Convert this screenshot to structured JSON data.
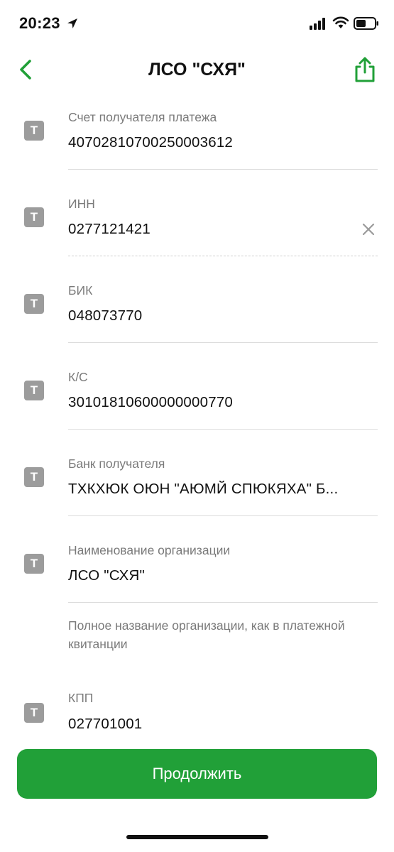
{
  "status_bar": {
    "time": "20:23",
    "icons": [
      "location-arrow-icon",
      "signal-icon",
      "wifi-icon",
      "battery-icon"
    ]
  },
  "nav": {
    "title": "ЛСО \"СХЯ\"",
    "back_icon": "chevron-left-icon",
    "share_icon": "share-icon"
  },
  "fields": [
    {
      "icon_letter": "T",
      "label": "Счет получателя платежа",
      "value": "40702810700250003612"
    },
    {
      "icon_letter": "T",
      "label": "ИНН",
      "value": "0277121421"
    },
    {
      "icon_letter": "T",
      "label": "БИК",
      "value": "048073770"
    },
    {
      "icon_letter": "T",
      "label": "К/С",
      "value": "30101810600000000770"
    },
    {
      "icon_letter": "T",
      "label": "Банк получателя",
      "value": "ТХКХЮК ОЮН \"АЮМЙ СПЮКЯХА\" Б..."
    },
    {
      "icon_letter": "T",
      "label": "Наименование организации",
      "value": "ЛСО \"СХЯ\""
    },
    {
      "icon_letter": "T",
      "label": "КПП",
      "value": "027701001"
    }
  ],
  "hint": "Полное название организации, как в платежной квитанции",
  "continue_button": "Продолжить",
  "colors": {
    "accent": "#21a038",
    "label": "#7a7a7a",
    "icon_bg": "#9c9c9c"
  }
}
